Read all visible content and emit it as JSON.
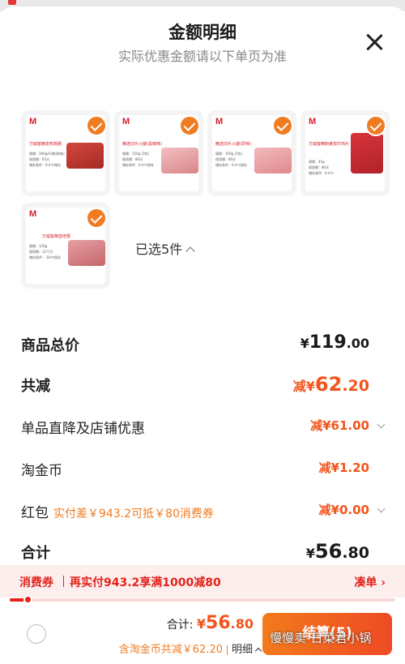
{
  "modal": {
    "title": "金额明细",
    "subtitle": "实际优惠金额请以下单页为准"
  },
  "products": [
    {
      "logo": "M",
      "name": "万威客脆皮热狗肠",
      "specs": [
        "规格：300g/10根(原味)",
        "保质期：65天",
        "储存条件：0-4℃保存"
      ],
      "photo_color": "#c9423a",
      "selected": true
    },
    {
      "logo": "M",
      "name": "精选切片火腿(黑椒味)",
      "specs": [
        "规格：150g (3包)",
        "保质期：80天",
        "储存条件：0-4℃保存"
      ],
      "photo_color": "#e8a6a8",
      "selected": true
    },
    {
      "logo": "M",
      "name": "精选切片火腿(原味)",
      "specs": [
        "规格：150g (3包)",
        "保质期：80天",
        "储存条件：0-4℃保存"
      ],
      "photo_color": "#eb9fa3",
      "selected": true
    },
    {
      "logo": "M",
      "name": "万威客精制番茄牛肉片",
      "specs": [
        "规格：45g",
        "保质期：80天",
        "储存条件：0-4℃"
      ],
      "photo_color": "#c75559",
      "selected": true
    },
    {
      "logo": "M",
      "name": "万威客精选培根",
      "specs": [
        "规格：120g",
        "保质期：12个月",
        "储存条件：-18℃保存"
      ],
      "photo_color": "#d98185",
      "selected": true
    }
  ],
  "selection": {
    "label": "已选5件"
  },
  "summary": {
    "goods_total": {
      "label": "商品总价",
      "prefix": "¥",
      "int": "119",
      "dec": ".00"
    },
    "total_discount": {
      "label": "共减",
      "prefix": "减¥",
      "int": "62",
      "dec": ".20"
    },
    "direct_discount": {
      "label": "单品直降及店铺优惠",
      "prefix": "减¥",
      "int": "61",
      "dec": ".00"
    },
    "gold_coin": {
      "label": "淘金币",
      "prefix": "减¥",
      "int": "1",
      "dec": ".20"
    },
    "red_packet": {
      "label": "红包",
      "hint": "实付差￥943.2可抵￥80消费券",
      "prefix": "减¥",
      "int": "0",
      "dec": ".00"
    },
    "subtotal": {
      "label": "合计",
      "prefix": "¥",
      "int": "56",
      "dec": ".80"
    }
  },
  "promo": {
    "tag": "消费券",
    "message": "再实付943.2享满1000减80",
    "link": "凑单 ›",
    "progress": 0.048
  },
  "footer": {
    "total_label": "合计:",
    "total_prefix": "¥",
    "total_int": "56",
    "total_dec": ".80",
    "detail_text": "含淘金币共减￥62.20",
    "detail_toggle": "明细",
    "checkout_label": "结算(5)",
    "watermark": "慢慢卖-日菜君小锅"
  },
  "colors": {
    "accent_orange": "#f2541b",
    "promo_red": "#e2231a",
    "check_orange": "#f07c22",
    "promo_bg": "#fdeeee"
  }
}
